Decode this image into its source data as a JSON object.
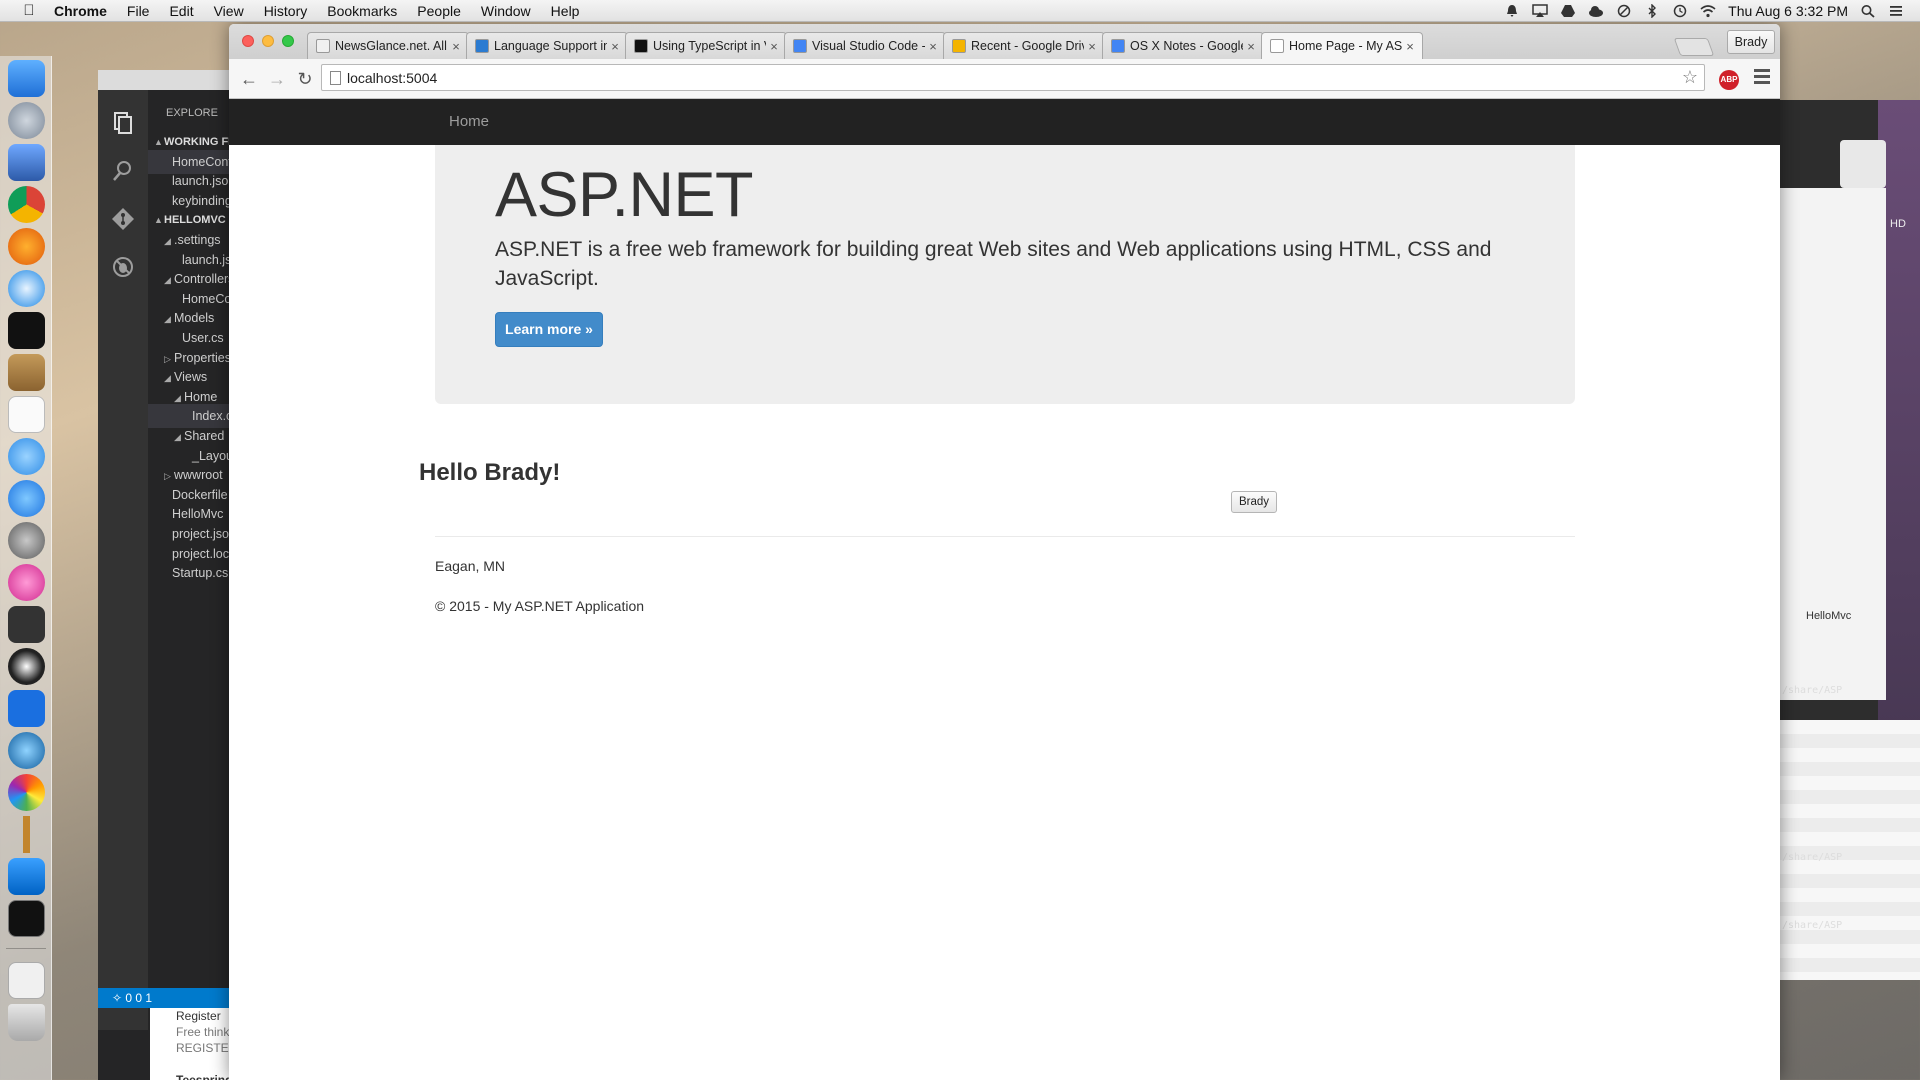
{
  "menubar": {
    "app_name": "Chrome",
    "menus": [
      "File",
      "Edit",
      "View",
      "History",
      "Bookmarks",
      "People",
      "Window",
      "Help"
    ],
    "clock": "Thu Aug 6  3:32 PM",
    "user": "Brady"
  },
  "vscode": {
    "explore_label": "EXPLORE",
    "status_text": "0  0  1",
    "tree": [
      {
        "label": "WORKING FILES",
        "twisty": "▲",
        "section": true
      },
      {
        "label": "HomeController.cs",
        "selected": true
      },
      {
        "label": "launch.json"
      },
      {
        "label": "keybindings.json"
      },
      {
        "label": "HELLOMVC",
        "twisty": "▲",
        "section": true
      },
      {
        "label": ".settings",
        "twisty": "◢"
      },
      {
        "label": "launch.json"
      },
      {
        "label": "Controllers",
        "twisty": "◢"
      },
      {
        "label": "HomeController.cs"
      },
      {
        "label": "Models",
        "twisty": "◢"
      },
      {
        "label": "User.cs"
      },
      {
        "label": "Properties",
        "twisty": "▷"
      },
      {
        "label": "Views",
        "twisty": "◢"
      },
      {
        "label": "Home",
        "twisty": "◢"
      },
      {
        "label": "Index.cshtml",
        "selected": true
      },
      {
        "label": "Shared",
        "twisty": "◢"
      },
      {
        "label": "_Layout.cshtml"
      },
      {
        "label": "wwwroot",
        "twisty": "▷"
      },
      {
        "label": "Dockerfile"
      },
      {
        "label": "HelloMvc"
      },
      {
        "label": "project.json"
      },
      {
        "label": "project.lock.json"
      },
      {
        "label": "Startup.cs"
      }
    ]
  },
  "background_page": {
    "lines": [
      "Register",
      "Free think",
      "REGISTE",
      "",
      "Teespring"
    ]
  },
  "right_window": {
    "hd_label": "HD",
    "path_lines": [
      "/share/ASP",
      "/share/ASP",
      "/share/ASP"
    ],
    "breadcrumb": "HelloMvc"
  },
  "chrome": {
    "tabs": [
      {
        "label": "NewsGlance.net. All your n",
        "favicon_color": "#f0f0f0"
      },
      {
        "label": "Language Support in Visual",
        "favicon_color": "#2b7bd1"
      },
      {
        "label": "Using TypeScript in Visual",
        "favicon_color": "#111111"
      },
      {
        "label": "Visual Studio Code - Goog",
        "favicon_color": "#4285f4"
      },
      {
        "label": "Recent - Google Drive",
        "favicon_color": "#f4b400"
      },
      {
        "label": "OS X Notes - Google Docs",
        "favicon_color": "#4285f4"
      },
      {
        "label": "Home Page - My ASP.NET",
        "favicon_color": "#ffffff",
        "active": true
      }
    ],
    "tab_close": "×",
    "profile": "Brady",
    "url": "localhost:5004",
    "abp_label": "ABP"
  },
  "site": {
    "nav_home": "Home",
    "jumbotron": {
      "title": "ASP.NET",
      "lead": "ASP.NET is a free web framework for building great Web sites and Web applications using HTML, CSS and JavaScript.",
      "button": "Learn more »"
    },
    "greeting": "Hello Brady!",
    "name_button": "Brady",
    "location": "Eagan, MN",
    "footer": "© 2015 - My ASP.NET Application"
  }
}
